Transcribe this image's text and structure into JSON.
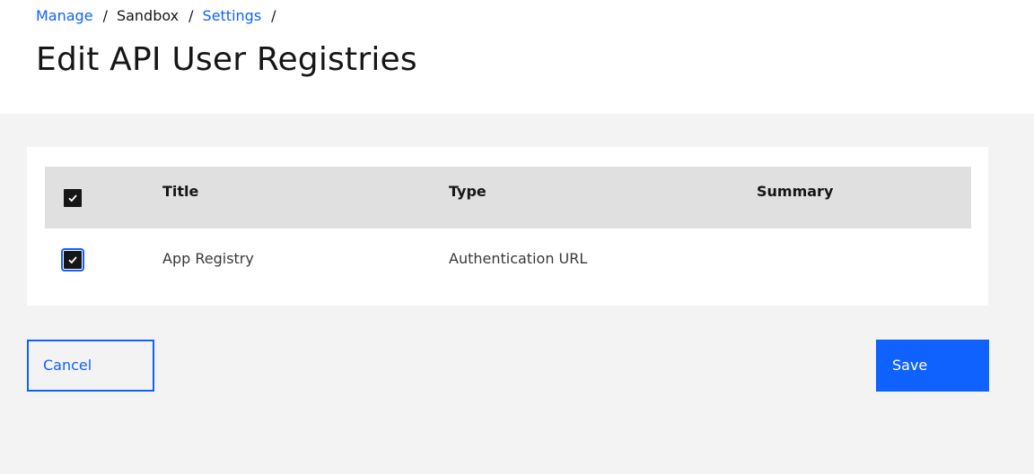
{
  "breadcrumb": {
    "items": [
      {
        "label": "Manage",
        "link": true
      },
      {
        "label": "Sandbox",
        "link": false
      },
      {
        "label": "Settings",
        "link": true
      }
    ],
    "separator": "/"
  },
  "page": {
    "title": "Edit API User Registries"
  },
  "table": {
    "headers": {
      "title": "Title",
      "type": "Type",
      "summary": "Summary"
    },
    "select_all_checked": true,
    "rows": [
      {
        "checked": true,
        "title": "App Registry",
        "type": "Authentication URL",
        "summary": ""
      }
    ]
  },
  "actions": {
    "cancel_label": "Cancel",
    "save_label": "Save"
  },
  "colors": {
    "primary": "#0f62fe",
    "header_bg": "#e0e0e0",
    "page_bg": "#f3f3f3",
    "text": "#161616"
  }
}
